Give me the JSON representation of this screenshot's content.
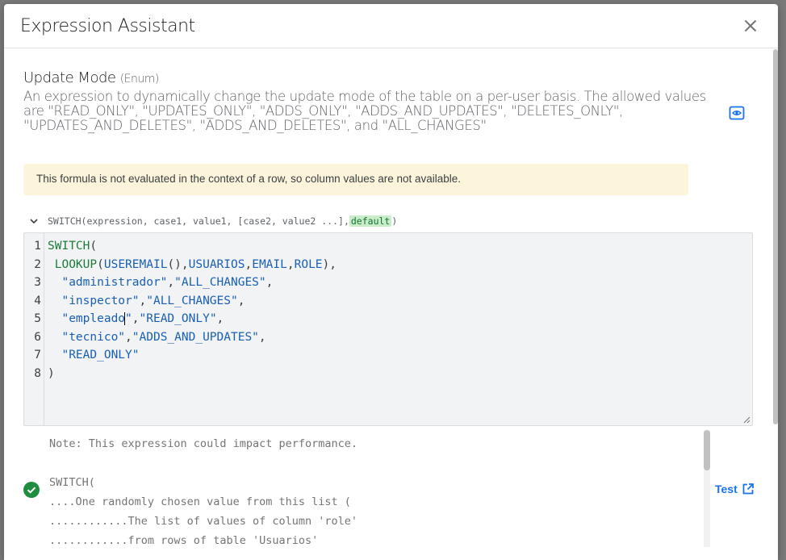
{
  "dialog": {
    "title": "Expression Assistant"
  },
  "field": {
    "name": "Update Mode",
    "type": "(Enum)",
    "description": "An expression to dynamically change the update mode of the table on a per-user basis. The allowed values are \"READ_ONLY\", \"UPDATES_ONLY\", \"ADDS_ONLY\", \"ADDS_AND_UPDATES\", \"DELETES_ONLY\", \"UPDATES_AND_DELETES\", \"ADDS_AND_DELETES\", and \"ALL_CHANGES\""
  },
  "warning": "This formula is not evaluated in the context of a row, so column values are not available.",
  "signature": {
    "text": "SWITCH(expression, case1, value1, [case2, value2 ...], ",
    "highlight": "default",
    "close": ")"
  },
  "editor": {
    "line_numbers": [
      "1",
      "2",
      "3",
      "4",
      "5",
      "6",
      "7",
      "8"
    ]
  },
  "note": "Note: This expression could impact performance.",
  "output_lines": [
    "SWITCH(",
    "....One randomly chosen value from this list (",
    "............The list of values of column 'role'",
    "............from rows of table 'Usuarios'"
  ],
  "test_label": "Test",
  "colors": {
    "accent": "#1a73e8",
    "success": "#1e8e3e",
    "warning_bg": "#fdf4dc"
  }
}
